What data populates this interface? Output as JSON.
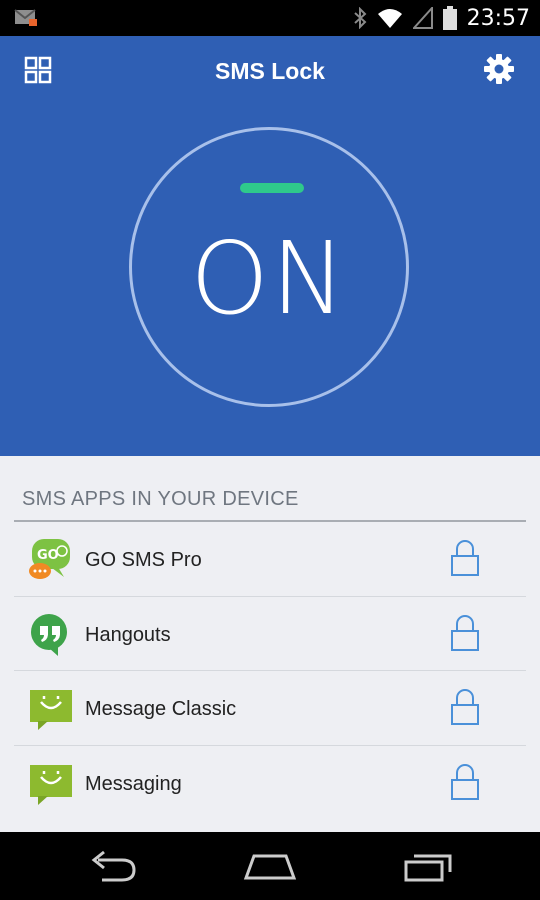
{
  "status_bar": {
    "time": "23:57",
    "icons": [
      "gmail-notification-icon",
      "bluetooth-icon",
      "wifi-icon",
      "signal-icon",
      "battery-icon"
    ]
  },
  "header": {
    "title": "SMS Lock",
    "background_color": "#2f5fb4",
    "toggle": {
      "state_text": "ON",
      "indicator_color": "#2fc98b"
    }
  },
  "list": {
    "section_title": "SMS APPS IN YOUR DEVICE",
    "apps": [
      {
        "name": "GO SMS Pro",
        "icon": "go-sms-icon",
        "locked": false
      },
      {
        "name": "Hangouts",
        "icon": "hangouts-icon",
        "locked": false
      },
      {
        "name": "Message Classic",
        "icon": "message-classic-icon",
        "locked": false
      },
      {
        "name": "Messaging",
        "icon": "messaging-icon",
        "locked": false
      }
    ],
    "lock_color": "#4a90d9"
  },
  "nav": {
    "buttons": [
      "back",
      "home",
      "recents"
    ]
  }
}
